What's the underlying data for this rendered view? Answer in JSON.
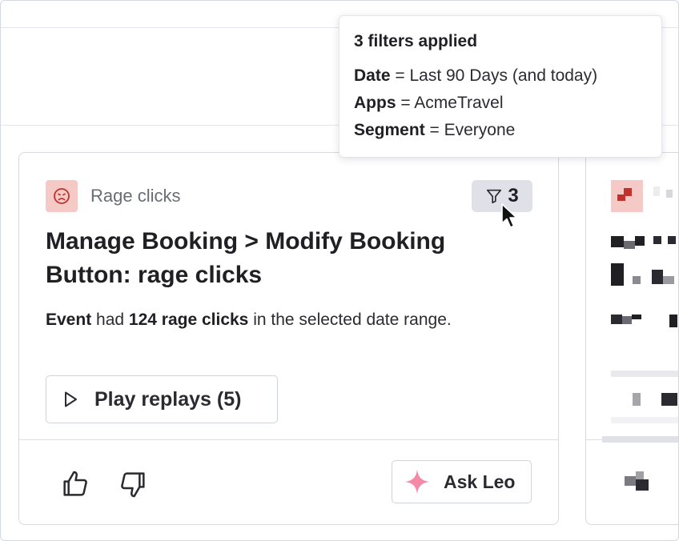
{
  "tooltip": {
    "title": "3 filters applied",
    "filters": [
      {
        "key": "Date",
        "value": "Last 90 Days (and today)"
      },
      {
        "key": "Apps",
        "value": "AcmeTravel"
      },
      {
        "key": "Segment",
        "value": "Everyone"
      }
    ],
    "separator": " = "
  },
  "card": {
    "type_label": "Rage clicks",
    "type_icon": "frown-face-icon",
    "filter_count": "3",
    "title": "Manage Booking > Modify Booking Button: rage clicks",
    "description": {
      "part1": "Event",
      "part2": " had ",
      "part3": "124 rage clicks",
      "part4": " in the selected date range."
    },
    "play_button_label": "Play replays (5)",
    "ask_button_label": "Ask Leo"
  },
  "colors": {
    "rage_icon_bg": "#f4c9c6",
    "rage_icon_fg": "#c0322b",
    "filter_chip_bg": "#dfe0e8",
    "sparkle": "#f48aa8",
    "border": "#d6d9df"
  }
}
